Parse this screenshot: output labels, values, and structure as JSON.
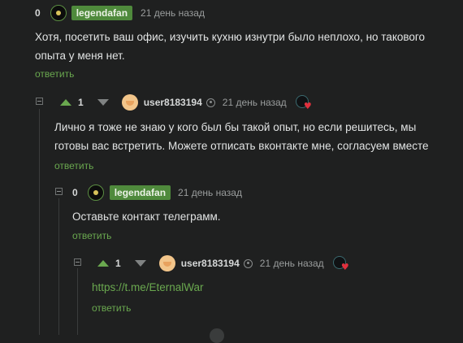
{
  "comments": [
    {
      "score": "0",
      "username": "legendafan",
      "date": "21 день назад",
      "text_lines": [
        "Хотя, посетить ваш офис, изучить кухню изнутри было неплохо, но такового",
        "опыта у меня нет."
      ],
      "reply_label": "ответить"
    },
    {
      "score": "1",
      "username": "user8183194",
      "date": "21 день назад",
      "text_lines": [
        "Лично я тоже не знаю у кого был бы такой опыт, но если решитесь, мы",
        "готовы вас встретить. Можете отписать вконтакте мне, согласуем вместе"
      ],
      "reply_label": "ответить"
    },
    {
      "score": "0",
      "username": "legendafan",
      "date": "21 день назад",
      "text_lines": [
        "Оставьте контакт телеграмм."
      ],
      "reply_label": "ответить"
    },
    {
      "score": "1",
      "username": "user8183194",
      "date": "21 день назад",
      "link_text": "https://t.me/EternalWar",
      "reply_label": "ответить"
    }
  ],
  "colors": {
    "background": "#1f2020",
    "accent_green": "#6aa84f",
    "badge_green": "#4f8a3c",
    "award_heart": "#e0303d"
  },
  "icons": {
    "upvote": "arrow-up-icon",
    "downvote": "arrow-down-icon",
    "collapse": "collapse-minus-icon",
    "profile": "person-icon",
    "award": "heart-award-icon"
  }
}
